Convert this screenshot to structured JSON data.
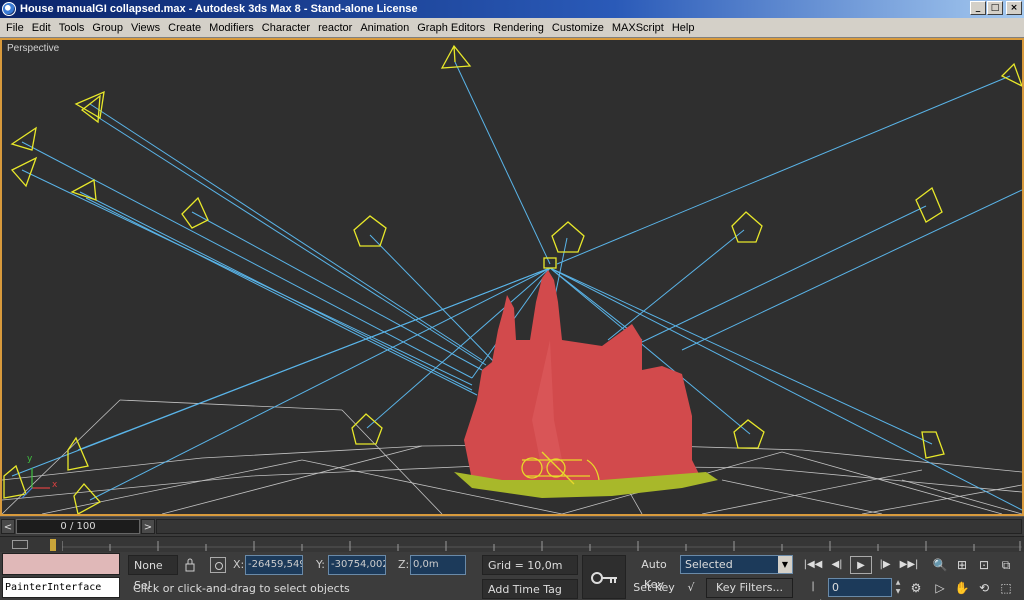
{
  "window": {
    "title": "House manualGI collapsed.max - Autodesk 3ds Max 8  - Stand-alone License",
    "min": "_",
    "max": "□",
    "close": "×"
  },
  "menu": [
    "File",
    "Edit",
    "Tools",
    "Group",
    "Views",
    "Create",
    "Modifiers",
    "Character",
    "reactor",
    "Animation",
    "Graph Editors",
    "Rendering",
    "Customize",
    "MAXScript",
    "Help"
  ],
  "viewport": {
    "label": "Perspective",
    "axis_x": "x",
    "axis_y": "y",
    "border_color": "#d89a3c"
  },
  "timeslider": {
    "position": "0 / 100",
    "prev": "<",
    "next": ">"
  },
  "status": {
    "selection": "None Sel",
    "x_label": "X:",
    "x_value": "-26459,549",
    "y_label": "Y:",
    "y_value": "-30754,002",
    "z_label": "Z:",
    "z_value": "0,0m",
    "grid": "Grid = 10,0m",
    "prompt": "Click or click-and-drag to select objects",
    "add_time_tag": "Add Time Tag"
  },
  "listener": {
    "top": "",
    "bottom": "PainterInterface"
  },
  "animation": {
    "auto_key": "Auto Key",
    "set_key": "Set Key",
    "key_mode": "Selected",
    "key_filters": "Key Filters...",
    "frame": "0"
  }
}
